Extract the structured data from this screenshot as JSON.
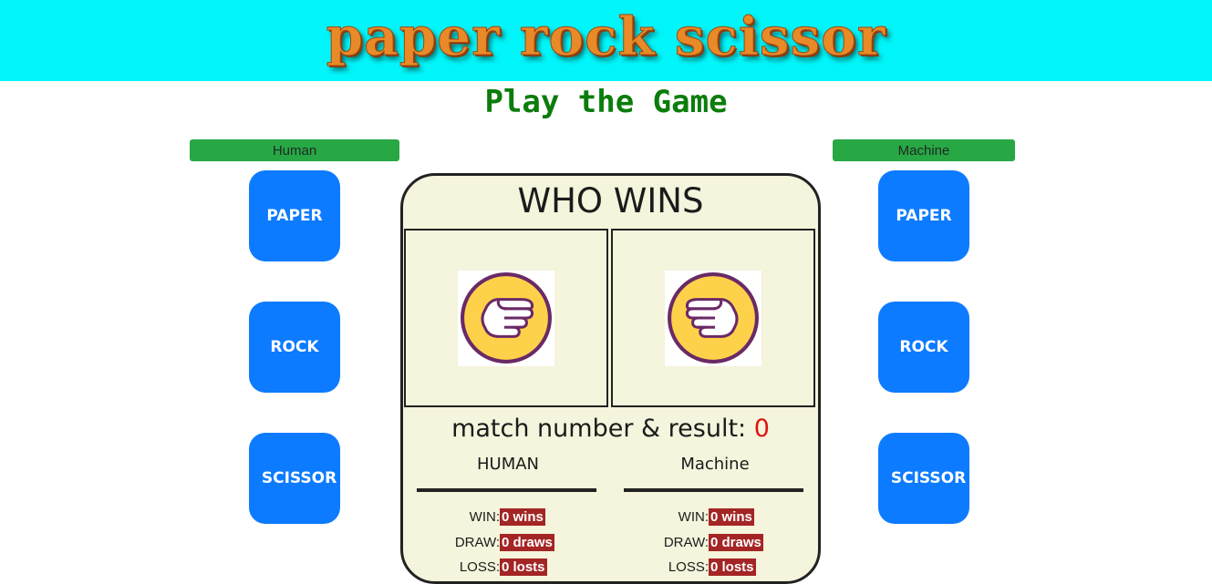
{
  "header": {
    "title": "paper rock scissor"
  },
  "subtitle": "Play the Game",
  "human_panel": {
    "label": "Human",
    "buttons": [
      "PAPER",
      "ROCK",
      "SCISSOR"
    ]
  },
  "machine_panel": {
    "label": "Machine",
    "buttons": [
      "PAPER",
      "ROCK",
      "SCISSOR"
    ]
  },
  "board": {
    "title": "WHO WINS",
    "human_choice_icon": "paper-hand-icon",
    "machine_choice_icon": "paper-hand-icon",
    "match_label": "match number & result:",
    "match_number": "0",
    "human_col": {
      "heading": "HUMAN",
      "win_label": "WIN:",
      "win_value": "0 wins",
      "draw_label": "DRAW:",
      "draw_value": "0 draws",
      "loss_label": "LOSS:",
      "loss_value": "0 losts"
    },
    "machine_col": {
      "heading": "Machine",
      "win_label": "WIN:",
      "win_value": "0 wins",
      "draw_label": "DRAW:",
      "draw_value": "0 draws",
      "loss_label": "LOSS:",
      "loss_value": "0 losts"
    }
  },
  "colors": {
    "banner_bg": "#00f6fa",
    "subtitle": "#0a7d0a",
    "label_green": "#28a745",
    "button_blue": "#0d7bff",
    "board_bg": "#f5f4dc",
    "badge_red": "#a42525",
    "match_number_red": "#e01212"
  }
}
